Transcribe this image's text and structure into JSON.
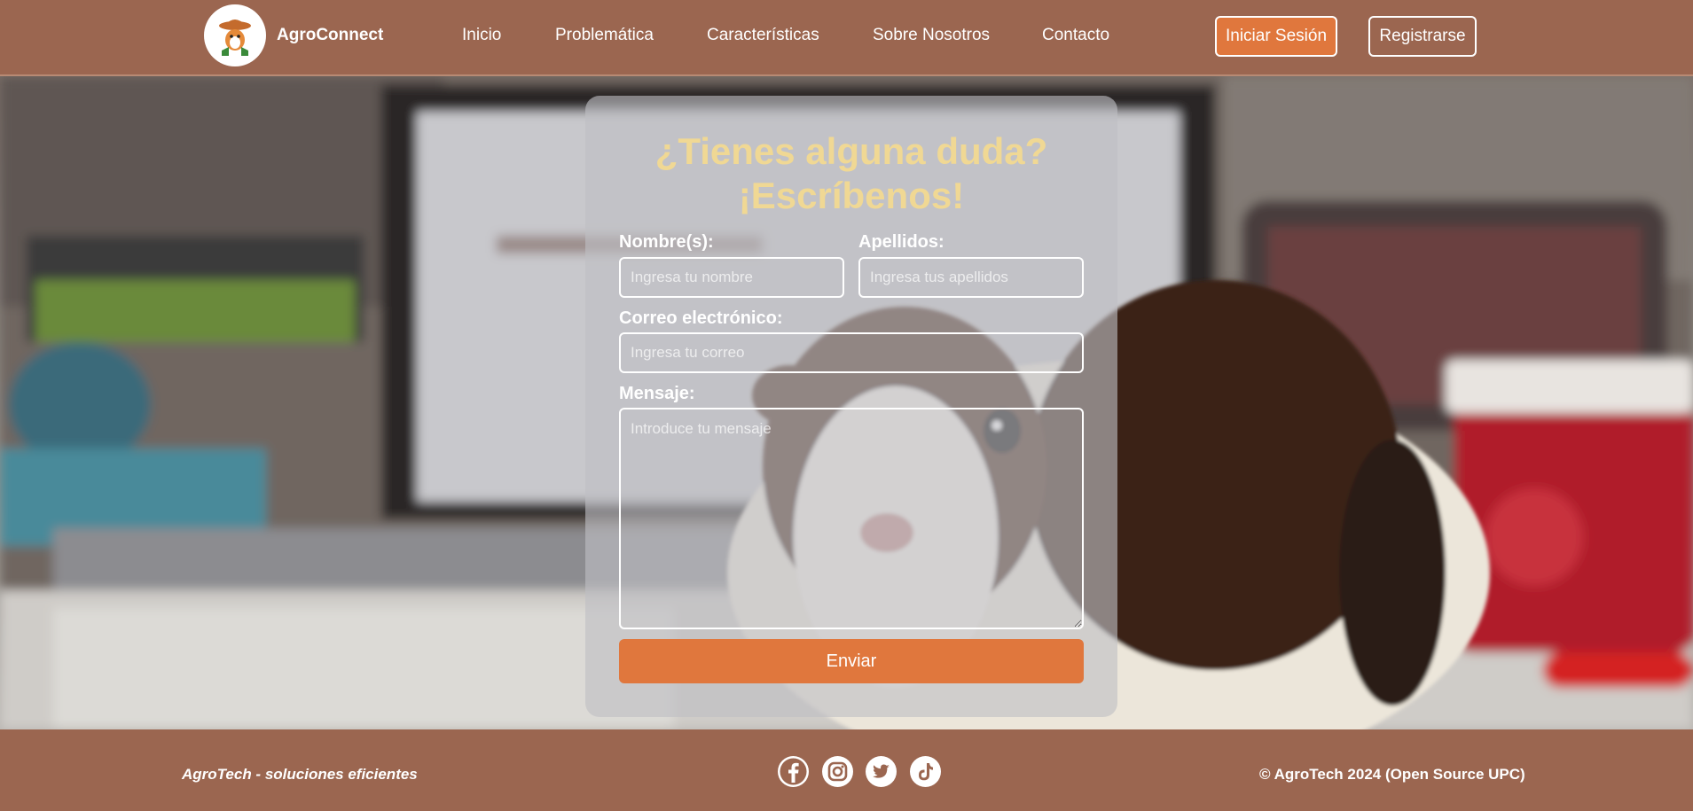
{
  "header": {
    "brand": "AgroConnect",
    "logo_icon": "guinea-pig-farmer-logo",
    "nav": [
      "Inicio",
      "Problemática",
      "Características",
      "Sobre Nosotros",
      "Contacto"
    ],
    "login_label": "Iniciar Sesión",
    "register_label": "Registrarse"
  },
  "form": {
    "title_line1": "¿Tienes alguna duda?",
    "title_line2": "¡Escríbenos!",
    "name_label": "Nombre(s):",
    "name_placeholder": "Ingresa tu nombre",
    "lastname_label": "Apellidos:",
    "lastname_placeholder": "Ingresa tus apellidos",
    "email_label": "Correo electrónico:",
    "email_placeholder": "Ingresa tu correo",
    "message_label": "Mensaje:",
    "message_placeholder": "Introduce tu mensaje",
    "submit_label": "Enviar"
  },
  "footer": {
    "tagline": "AgroTech - soluciones eficientes",
    "copyright": "© AgroTech 2024 (Open Source UPC)",
    "social_icons": [
      "facebook-icon",
      "instagram-icon",
      "twitter-icon",
      "tiktok-icon"
    ]
  },
  "colors": {
    "header_bg": "#9b6650",
    "accent_orange": "#e0773d",
    "title_yellow": "#f0d894",
    "card_bg": "rgba(190,190,196,0.62)"
  }
}
